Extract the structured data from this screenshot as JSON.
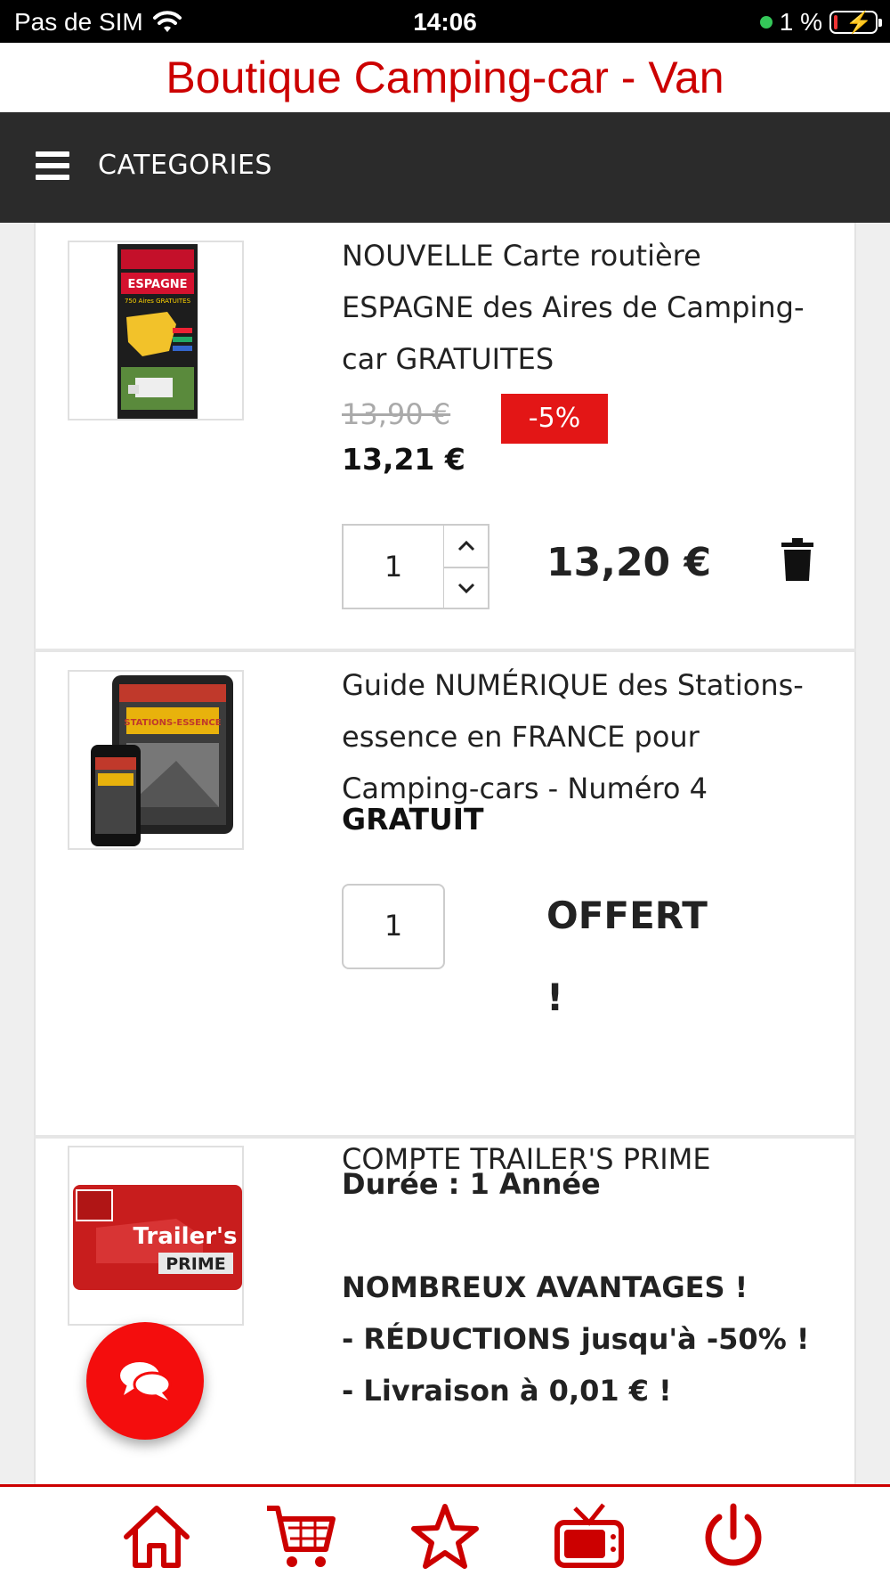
{
  "status_bar": {
    "carrier": "Pas de SIM",
    "time": "14:06",
    "battery": "1 %"
  },
  "header": {
    "title": "Boutique Camping-car - Van"
  },
  "nav": {
    "menu_label": "CATEGORIES"
  },
  "cart_items": [
    {
      "name": "NOUVELLE Carte routière ESPAGNE des Aires de Camping-car GRATUITES",
      "old_price": "13,90 €",
      "discount": "-5%",
      "price": "13,21 €",
      "quantity": "1",
      "line_total": "13,20 €",
      "thumb_title": "ESPAGNE",
      "thumb_subtitle": "750 Aires GRATUITES"
    },
    {
      "name": "Guide NUMÉRIQUE des Stations-essence en FRANCE pour Camping-cars - Numéro 4",
      "price": "GRATUIT",
      "quantity": "1",
      "line_total": "OFFERT !",
      "thumb_title": "STATIONS-ESSENCE"
    },
    {
      "name": "COMPTE TRAILER'S PRIME",
      "detail_1": "Durée : 1 Année",
      "detail_2": "NOMBREUX AVANTAGES !",
      "detail_3": "- RÉDUCTIONS jusqu'à -50% !",
      "detail_4": "- Livraison à 0,01 € !",
      "thumb_line_1": "Trailer's",
      "thumb_line_2": "PRIME"
    }
  ],
  "icons": {
    "wifi": "wifi-icon",
    "charging": "charging-icon",
    "menu": "hamburger-icon",
    "stepper_up": "chevron-up-icon",
    "stepper_down": "chevron-down-icon",
    "delete": "trash-icon",
    "chat": "chat-icon",
    "home": "home-icon",
    "cart": "cart-icon",
    "favorites": "star-icon",
    "tv": "tv-icon",
    "power": "power-icon"
  },
  "colors": {
    "brand_red": "#cc0000",
    "badge_red": "#e31616",
    "nav_dark": "#2b2b2b"
  }
}
